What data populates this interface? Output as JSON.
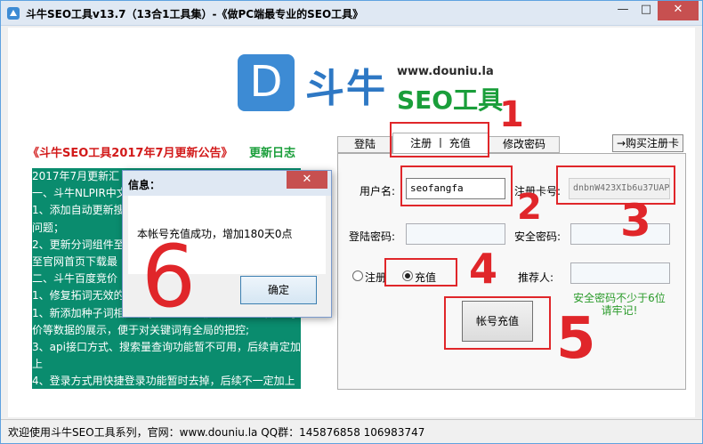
{
  "window": {
    "title": "斗牛SEO工具v13.7（13合1工具集）-《做PC端最专业的SEO工具》",
    "min_icon": "minimize-icon",
    "max_icon": "maximize-icon",
    "close_icon": "close-icon"
  },
  "logo": {
    "badge_letter": "D",
    "brand_cn": "斗牛",
    "url": "www.douniu.la",
    "product": "SEO工具"
  },
  "notice": {
    "title": "《斗牛SEO工具2017年7月更新公告》",
    "log_link": "更新日志",
    "lines": [
      "2017年7月更新汇",
      "一、斗牛NLPIR中文",
      "1、添加自动更新搜",
      "问题；",
      "2、更新分词组件至",
      "至官网首页下载最",
      "二、斗牛百度竞价",
      "1、修复拓词无效的",
      "1、新添加种子词相关搜索量、PC、移动、ocm出现的子",
      "价等数据的展示，便于对关键词有全局的把控;",
      "3、api接口方式、搜索量查询功能暂不可用，后续肯定加",
      "上",
      "4、登录方式用快捷登录功能暂时去掉，后续不一定加上"
    ]
  },
  "tabs": {
    "login": "登陆",
    "register": "注册 丨 充值",
    "change_pwd": "修改密码"
  },
  "buy_card": "→购买注册卡",
  "form": {
    "username_label": "用户名:",
    "username_value": "seofangfa",
    "card_label": "注册卡号:",
    "card_value": "dnbnW423XIb6u37UAP",
    "login_pwd_label": "登陆密码:",
    "security_pwd_label": "安全密码:",
    "radio_register": "注册",
    "radio_recharge": "充值",
    "referrer_label": "推荐人:",
    "hint_line1": "安全密码不少于6位",
    "hint_line2": "请牢记!",
    "recharge_button": "帐号充值"
  },
  "dialog": {
    "title": "信息：",
    "message": "本帐号充值成功，增加180天0点",
    "ok_button": "确定"
  },
  "annotations": [
    "1",
    "2",
    "3",
    "4",
    "5",
    "6"
  ],
  "status": {
    "text": "欢迎使用斗牛SEO工具系列，官网：www.douniu.la    QQ群：145876858  106983747"
  },
  "colors": {
    "accent_blue": "#3d8bd4",
    "brand_green": "#1a9e3a",
    "changelog_bg": "#0a8c6e",
    "notice_red": "#d21a1a",
    "annotation_red": "#e0262a",
    "hint_green": "#2b9b2b"
  }
}
